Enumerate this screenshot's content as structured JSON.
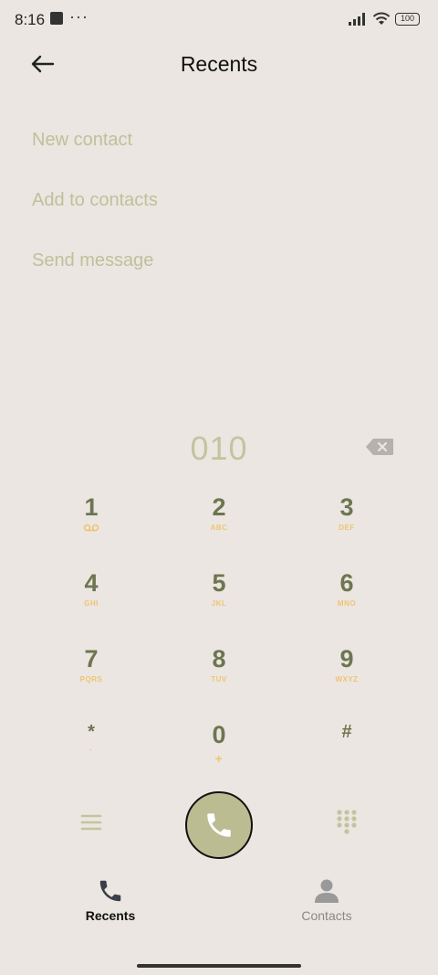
{
  "status_bar": {
    "time": "8:16",
    "dots": "···",
    "battery": "100"
  },
  "header": {
    "title": "Recents"
  },
  "actions": [
    "New contact",
    "Add to contacts",
    "Send message"
  ],
  "dialed_number": "010",
  "keys": [
    {
      "digit": "1",
      "letters": ""
    },
    {
      "digit": "2",
      "letters": "ABC"
    },
    {
      "digit": "3",
      "letters": "DEF"
    },
    {
      "digit": "4",
      "letters": "GHI"
    },
    {
      "digit": "5",
      "letters": "JKL"
    },
    {
      "digit": "6",
      "letters": "MNO"
    },
    {
      "digit": "7",
      "letters": "PQRS"
    },
    {
      "digit": "8",
      "letters": "TUV"
    },
    {
      "digit": "9",
      "letters": "WXYZ"
    },
    {
      "digit": "*",
      "letters": "·"
    },
    {
      "digit": "0",
      "letters": "+"
    },
    {
      "digit": "#",
      "letters": ""
    }
  ],
  "nav": {
    "recents": "Recents",
    "contacts": "Contacts"
  },
  "colors": {
    "background": "#ebe6e1",
    "accent_green": "#bcbc93",
    "digit": "#6e7550",
    "letters": "#efc472",
    "action_text": "#bfc09b"
  }
}
